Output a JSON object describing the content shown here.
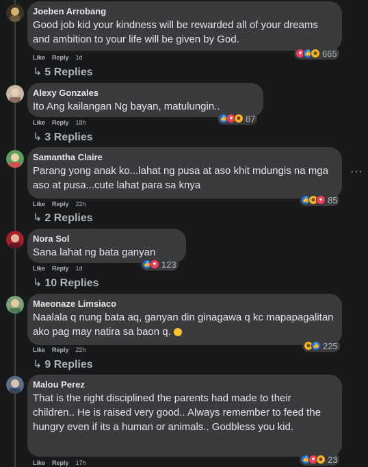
{
  "comments": [
    {
      "author": "Joeben Arrobang",
      "text": "Good job kid your kindness will be rewarded all of your dreams and ambition to your life will be given by God.",
      "like": "Like",
      "reply": "Reply",
      "time": "1d",
      "reactions": "665",
      "replies": "5 Replies"
    },
    {
      "author": "Alexy Gonzales",
      "text": "Ito Ang kailangan Ng bayan, matulungin..",
      "like": "Like",
      "reply": "Reply",
      "time": "18h",
      "reactions": "87",
      "replies": "3 Replies"
    },
    {
      "author": "Samantha Claire",
      "text": "Parang yong anak ko...lahat ng pusa at aso khit mdungis na mga aso at pusa...cute lahat para sa knya",
      "like": "Like",
      "reply": "Reply",
      "time": "22h",
      "reactions": "85",
      "replies": "2 Replies"
    },
    {
      "author": "Nora Sol",
      "text": "Sana lahat ng bata ganyan",
      "like": "Like",
      "reply": "Reply",
      "time": "1d",
      "reactions": "123",
      "replies": "10 Replies"
    },
    {
      "author": "Maeonaze Limsiaco",
      "text": "Naalala q nung bata aq, ganyan din ginagawa q kc mapapagalitan ako pag may natira sa baon q.",
      "like": "Like",
      "reply": "Reply",
      "time": "22h",
      "reactions": "225",
      "replies": "9 Replies"
    },
    {
      "author": "Malou Perez",
      "text": "That is the right disciplined the parents had made to their children.. He is raised very good.. Always remember to feed the hungry even if its a human or animals.. Godbless you kid.",
      "like": "Like",
      "reply": "Reply",
      "time": "17h",
      "reactions": "23"
    }
  ],
  "more_icon": "···",
  "reply_arrow": "↳",
  "colors": {
    "background": "#18191a",
    "bubble": "#3a3b3c",
    "text": "#e4e6eb",
    "muted": "#b0b3b8"
  }
}
